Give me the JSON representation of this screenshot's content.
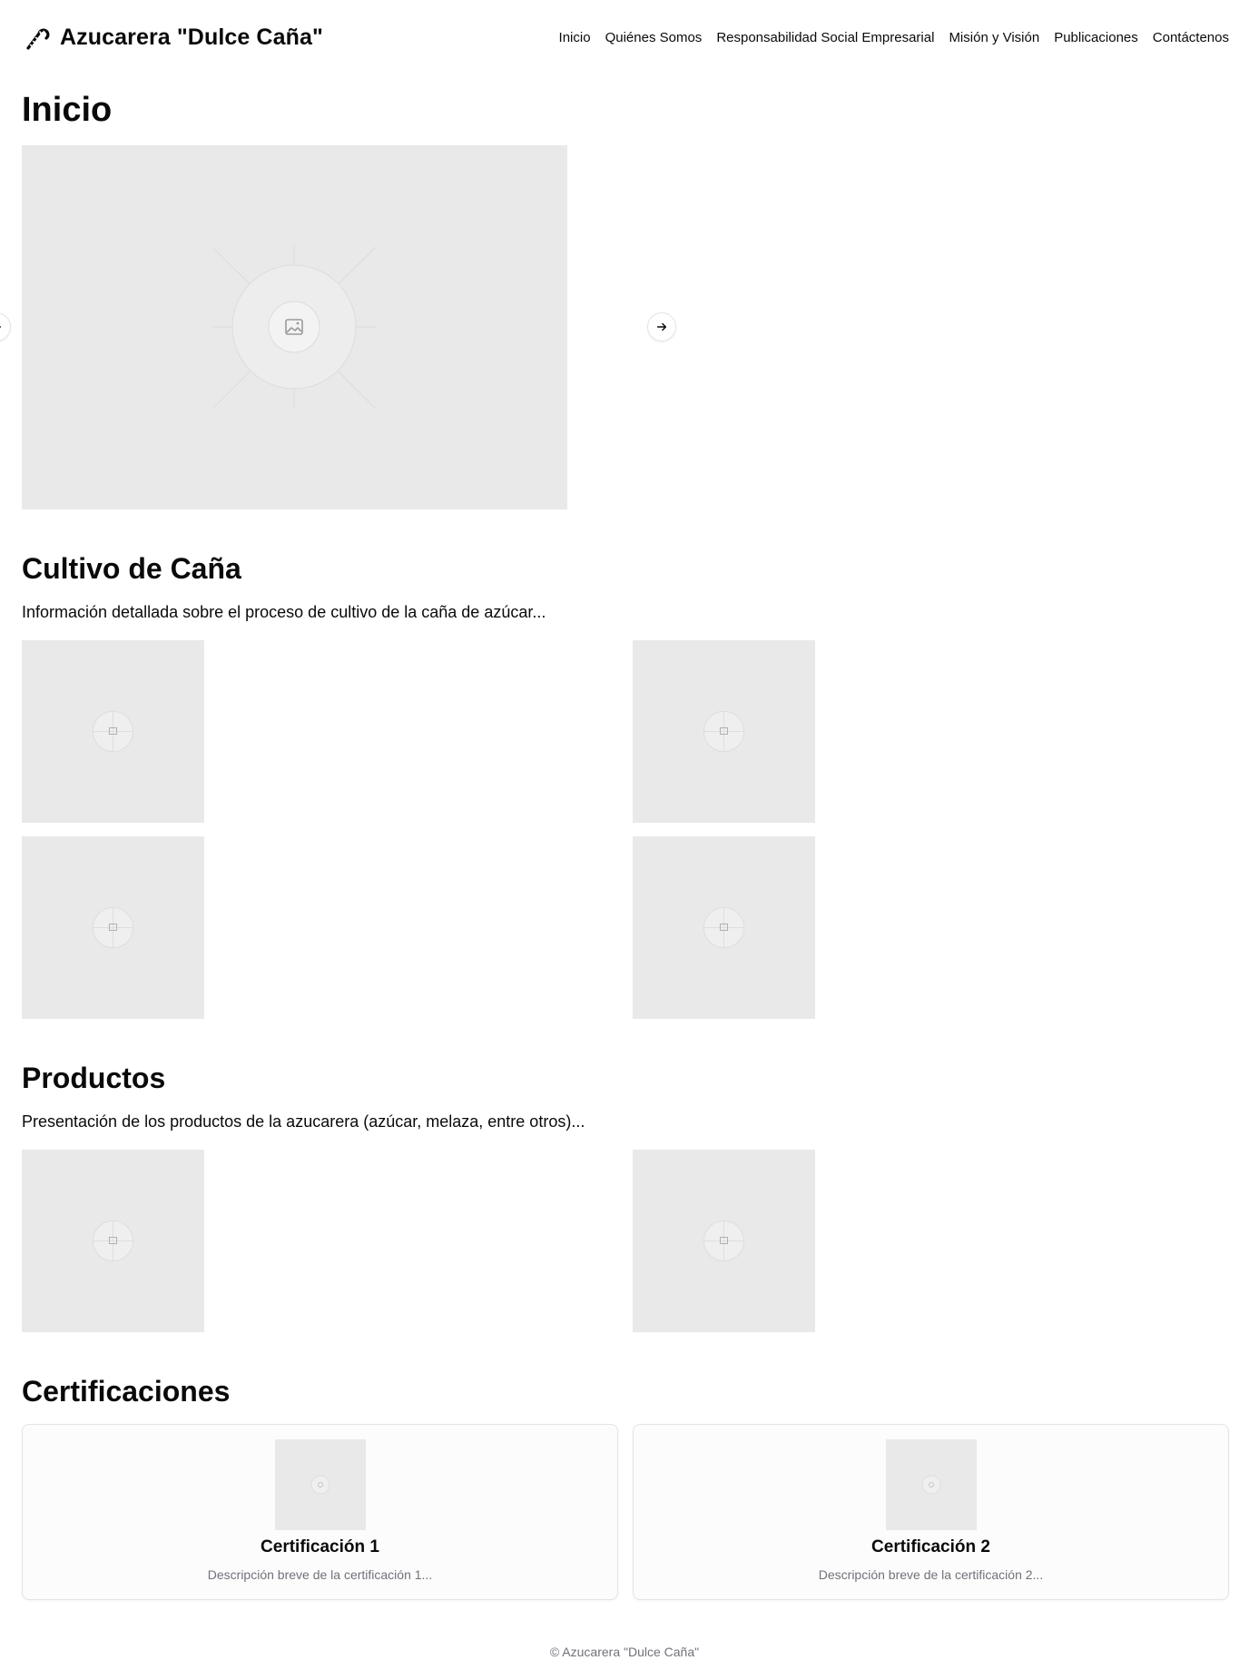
{
  "header": {
    "brand_icon": "candy-cane-icon",
    "brand_name": "Azucarera \"Dulce Caña\"",
    "nav": [
      {
        "label": "Inicio"
      },
      {
        "label": "Quiénes Somos"
      },
      {
        "label": "Responsabilidad Social Empresarial"
      },
      {
        "label": "Misión y Visión"
      },
      {
        "label": "Publicaciones"
      },
      {
        "label": "Contáctenos"
      }
    ]
  },
  "inicio": {
    "title": "Inicio",
    "carousel": {
      "prev_icon": "arrow-left-icon",
      "next_icon": "arrow-right-icon",
      "slide_icon": "image-placeholder-icon"
    }
  },
  "cultivo": {
    "title": "Cultivo de Caña",
    "description": "Información detallada sobre el proceso de cultivo de la caña de azúcar..."
  },
  "productos": {
    "title": "Productos",
    "description": "Presentación de los productos de la azucarera (azúcar, melaza, entre otros)..."
  },
  "certificaciones": {
    "title": "Certificaciones",
    "items": [
      {
        "title": "Certificación 1",
        "description": "Descripción breve de la certificación 1..."
      },
      {
        "title": "Certificación 2",
        "description": "Descripción breve de la certificación 2..."
      }
    ]
  },
  "footer": {
    "text": "© Azucarera \"Dulce Caña\""
  },
  "colors": {
    "placeholder_bg": "#e9e9e9",
    "text": "#0a0a0a",
    "muted": "#71717a",
    "border": "#e4e4e7"
  }
}
